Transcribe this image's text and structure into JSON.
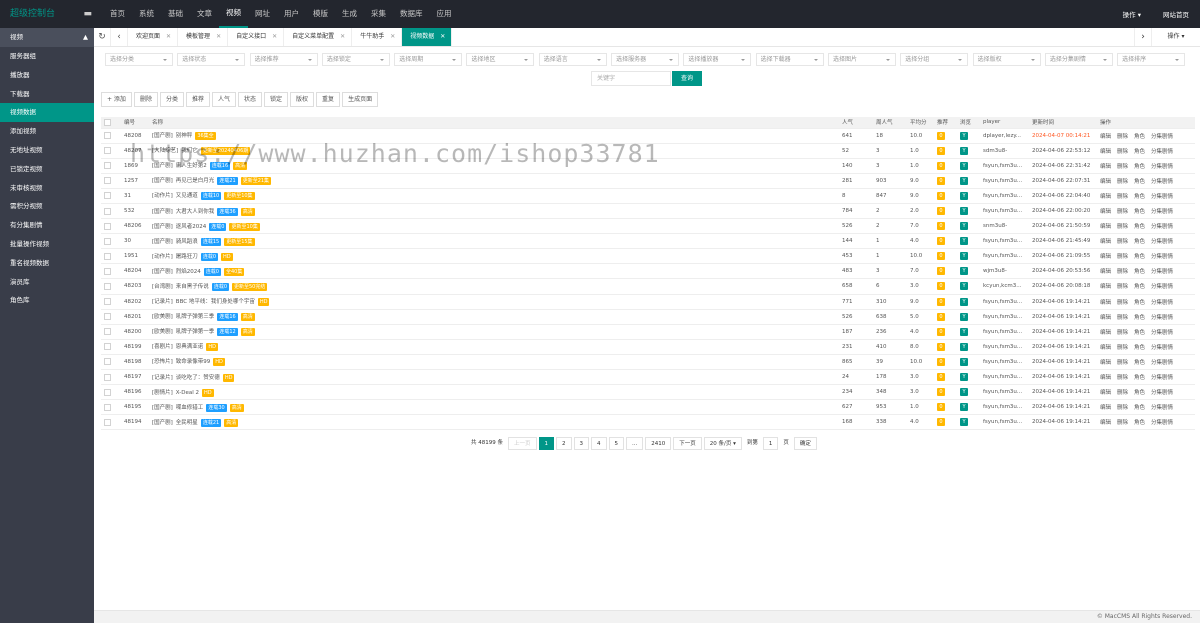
{
  "header": {
    "logo": "超级控制台",
    "fold": "▬",
    "nav": [
      "首页",
      "系统",
      "基础",
      "文章",
      "视频",
      "网址",
      "用户",
      "模版",
      "生成",
      "采集",
      "数据库",
      "应用"
    ],
    "active_nav": 4,
    "op": "操作 ▾",
    "home": "网站首页"
  },
  "sidebar": {
    "title": "视频",
    "collapse": "▲",
    "items": [
      "服务器组",
      "播放器",
      "下载器",
      "视频数据",
      "添加视频",
      "无地址视频",
      "已锁定视频",
      "未审核视频",
      "需积分视频",
      "有分集剧情",
      "批量操作视频",
      "重名视频数据",
      "演员库",
      "角色库"
    ],
    "active": 3
  },
  "tabs": {
    "items": [
      "欢迎页面",
      "模板管理",
      "自定义接口",
      "自定义菜单配置",
      "牛牛助手",
      "视频数据"
    ],
    "active": 5,
    "op": "操作 ▾"
  },
  "filters": [
    "选择分类",
    "选择状态",
    "选择推荐",
    "选择锁定",
    "选择周期",
    "选择地区",
    "选择语言",
    "选择服务器",
    "选择播放器",
    "选择下载器",
    "选择图片",
    "选择分组",
    "选择版权",
    "选择分集剧情",
    "选择排序"
  ],
  "search": {
    "placeholder": "关键字",
    "button": "查询"
  },
  "actions": [
    "+ 添加",
    "删除",
    "分类",
    "推荐",
    "人气",
    "状态",
    "锁定",
    "版权",
    "重复",
    "生成页面"
  ],
  "watermark": "https://www.huzhan.com/ishop33781",
  "columns": [
    "",
    "编号",
    "名称",
    "人气",
    "周人气",
    "平均分",
    "推荐",
    "浏览",
    "player",
    "更新时间",
    "操作"
  ],
  "colors": {
    "teal": "#009688",
    "blue": "#1e9fff",
    "orange": "#ffb800",
    "green": "#5fb878"
  },
  "rows": [
    {
      "id": "48208",
      "cat": "[国产剧]",
      "name": "别神秤",
      "b": [
        [
          "36集全",
          "orange"
        ]
      ],
      "hits": "641",
      "week": "18",
      "score": "10.0",
      "player": "dplayer,lezy...",
      "time": "2024-04-07 00:14:21",
      "red": true
    },
    {
      "id": "48207",
      "cat": "[大陆综艺]",
      "name": "我们它",
      "b": [
        [
          "更新至20240406期",
          "orange"
        ]
      ],
      "hits": "52",
      "week": "3",
      "score": "1.0",
      "player": "sdm3u8-",
      "time": "2024-04-06 22:53:12"
    },
    {
      "id": "1869",
      "cat": "[国产剧]",
      "name": "庸人生好第2",
      "b": [
        [
          "连载16",
          "blue"
        ],
        [
          "高清",
          "orange"
        ]
      ],
      "hits": "140",
      "week": "3",
      "score": "1.0",
      "player": "fsyun,fsm3u...",
      "time": "2024-04-06 22:31:42"
    },
    {
      "id": "1257",
      "cat": "[国产剧]",
      "name": "再见已是白月光",
      "b": [
        [
          "连载21",
          "blue"
        ],
        [
          "更新至21集",
          "orange"
        ]
      ],
      "hits": "281",
      "week": "903",
      "score": "9.0",
      "player": "fsyun,fsm3u...",
      "time": "2024-04-06 22:07:31"
    },
    {
      "id": "31",
      "cat": "[动作片]",
      "name": "又见通道",
      "b": [
        [
          "连载10",
          "blue"
        ],
        [
          "更新至10集",
          "orange"
        ]
      ],
      "hits": "8",
      "week": "847",
      "score": "9.0",
      "player": "fsyun,fsm3u...",
      "time": "2024-04-06 22:04:40"
    },
    {
      "id": "532",
      "cat": "[国产剧]",
      "name": "大君大人到你我",
      "b": [
        [
          "连载36",
          "blue"
        ],
        [
          "高清",
          "orange"
        ]
      ],
      "hits": "784",
      "week": "2",
      "score": "2.0",
      "player": "fsyun,fsm3u...",
      "time": "2024-04-06 22:00:20"
    },
    {
      "id": "48206",
      "cat": "[国产剧]",
      "name": "逐风者2024",
      "b": [
        [
          "连载0",
          "blue"
        ],
        [
          "更新至10集",
          "orange"
        ]
      ],
      "hits": "526",
      "week": "2",
      "score": "7.0",
      "player": "snm3u8-",
      "time": "2024-04-06 21:50:59"
    },
    {
      "id": "30",
      "cat": "[国产剧]",
      "name": "骑风蹈浪",
      "b": [
        [
          "连载15",
          "blue"
        ],
        [
          "更新至15集",
          "orange"
        ]
      ],
      "hits": "144",
      "week": "1",
      "score": "4.0",
      "player": "fsyun,fsm3u...",
      "time": "2024-04-06 21:45:49"
    },
    {
      "id": "1951",
      "cat": "[动作片]",
      "name": "屠路狂刀",
      "b": [
        [
          "连载0",
          "blue"
        ],
        [
          "HD",
          "orange"
        ]
      ],
      "hits": "453",
      "week": "1",
      "score": "10.0",
      "player": "fsyun,fsm3u...",
      "time": "2024-04-06 21:09:55"
    },
    {
      "id": "48204",
      "cat": "[国产剧]",
      "name": "烈焰2024",
      "b": [
        [
          "连载0",
          "blue"
        ],
        [
          "全40集",
          "orange"
        ]
      ],
      "hits": "483",
      "week": "3",
      "score": "7.0",
      "player": "wjm3u8-",
      "time": "2024-04-06 20:53:56"
    },
    {
      "id": "48203",
      "cat": "[台湾剧]",
      "name": "来自黑子传说",
      "b": [
        [
          "连载0",
          "blue"
        ],
        [
          "更新至50完结",
          "orange"
        ]
      ],
      "hits": "658",
      "week": "6",
      "score": "3.0",
      "player": "kcyun,kcm3...",
      "time": "2024-04-06 20:08:18"
    },
    {
      "id": "48202",
      "cat": "[记录片]",
      "name": "BBC 地平线：我们身处哪个宇宙",
      "b": [
        [
          "HD",
          "orange"
        ]
      ],
      "hits": "771",
      "week": "310",
      "score": "9.0",
      "player": "fsyun,fsm3u...",
      "time": "2024-04-06 19:14:21"
    },
    {
      "id": "48201",
      "cat": "[欧美剧]",
      "name": "吼牌子弹第三季",
      "b": [
        [
          "连载16",
          "blue"
        ],
        [
          "高清",
          "orange"
        ]
      ],
      "hits": "526",
      "week": "638",
      "score": "5.0",
      "player": "fsyun,fsm3u...",
      "time": "2024-04-06 19:14:21"
    },
    {
      "id": "48200",
      "cat": "[欧美剧]",
      "name": "吼牌子弹第一季",
      "b": [
        [
          "连载12",
          "blue"
        ],
        [
          "高清",
          "orange"
        ]
      ],
      "hits": "187",
      "week": "236",
      "score": "4.0",
      "player": "fsyun,fsm3u...",
      "time": "2024-04-06 19:14:21"
    },
    {
      "id": "48199",
      "cat": "[喜剧片]",
      "name": "恩典满亚诺",
      "b": [
        [
          "HD",
          "orange"
        ]
      ],
      "hits": "231",
      "week": "410",
      "score": "8.0",
      "player": "fsyun,fsm3u...",
      "time": "2024-04-06 19:14:21"
    },
    {
      "id": "48198",
      "cat": "[恐怖片]",
      "name": "致命录像带99",
      "b": [
        [
          "HD",
          "orange"
        ]
      ],
      "hits": "865",
      "week": "39",
      "score": "10.0",
      "player": "fsyun,fsm3u...",
      "time": "2024-04-06 19:14:21"
    },
    {
      "id": "48197",
      "cat": "[记录片]",
      "name": "谈吃吃了：赞安德",
      "b": [
        [
          "HD",
          "orange"
        ]
      ],
      "hits": "24",
      "week": "178",
      "score": "3.0",
      "player": "fsyun,fsm3u...",
      "time": "2024-04-06 19:14:21"
    },
    {
      "id": "48196",
      "cat": "[剧情片]",
      "name": "X-Deal 2",
      "b": [
        [
          "HD",
          "orange"
        ]
      ],
      "hits": "234",
      "week": "348",
      "score": "3.0",
      "player": "fsyun,fsm3u...",
      "time": "2024-04-06 19:14:21"
    },
    {
      "id": "48195",
      "cat": "[国产剧]",
      "name": "喋血修猎工",
      "b": [
        [
          "连载30",
          "blue"
        ],
        [
          "高清",
          "orange"
        ]
      ],
      "hits": "627",
      "week": "953",
      "score": "1.0",
      "player": "fsyun,fsm3u...",
      "time": "2024-04-06 19:14:21"
    },
    {
      "id": "48194",
      "cat": "[国产剧]",
      "name": "全民明星",
      "b": [
        [
          "连载21",
          "blue"
        ],
        [
          "高清",
          "orange"
        ]
      ],
      "hits": "168",
      "week": "338",
      "score": "4.0",
      "player": "fsyun,fsm3u...",
      "time": "2024-04-06 19:14:21"
    }
  ],
  "row_flags": {
    "recommend": "0",
    "browse": "Y"
  },
  "row_ops": [
    "编辑",
    "删除",
    "角色",
    "分集剧情"
  ],
  "pager": {
    "total": "共 48199 条",
    "prev": "上一页",
    "pages": [
      "1",
      "2",
      "3",
      "4",
      "5",
      "...",
      "2410"
    ],
    "active": 0,
    "next": "下一页",
    "size": "20 条/页 ▾",
    "goto": "到第",
    "goto_val": "1",
    "page_word": "页",
    "confirm": "确定"
  },
  "footer": "© MacCMS All Rights Reserved."
}
